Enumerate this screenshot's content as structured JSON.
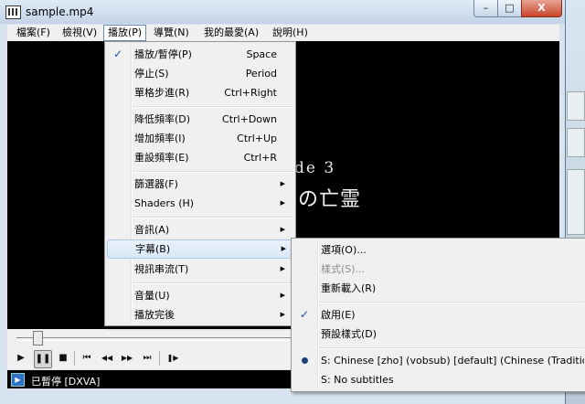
{
  "window": {
    "title": "sample.mp4",
    "buttons": {
      "minimize": "–",
      "maximize": "□",
      "close": "X"
    }
  },
  "menubar": [
    "檔案(F)",
    "檢視(V)",
    "播放(P)",
    "導覽(N)",
    "我的最愛(A)",
    "說明(H)"
  ],
  "play_menu": {
    "items": [
      {
        "label": "播放/暫停(P)",
        "shortcut": "Space",
        "checked": true
      },
      {
        "label": "停止(S)",
        "shortcut": "Period"
      },
      {
        "label": "單格步進(R)",
        "shortcut": "Ctrl+Right"
      },
      {
        "label": "降低頻率(D)",
        "shortcut": "Ctrl+Down"
      },
      {
        "label": "增加頻率(I)",
        "shortcut": "Ctrl+Up"
      },
      {
        "label": "重設頻率(E)",
        "shortcut": "Ctrl+R"
      },
      {
        "label": "篩選器(F)",
        "submenu": true
      },
      {
        "label": "Shaders (H)",
        "submenu": true
      },
      {
        "label": "音訊(A)",
        "submenu": true
      },
      {
        "label": "字幕(B)",
        "submenu": true,
        "highlighted": true
      },
      {
        "label": "視訊串流(T)",
        "submenu": true
      },
      {
        "label": "音量(U)",
        "submenu": true
      },
      {
        "label": "播放完後",
        "submenu": true
      }
    ]
  },
  "subtitle_menu": {
    "items": [
      {
        "label": "選項(O)..."
      },
      {
        "label": "樣式(S)...",
        "disabled": true
      },
      {
        "label": "重新載入(R)"
      },
      {
        "label": "啟用(E)",
        "checked": true
      },
      {
        "label": "預設樣式(D)"
      },
      {
        "label": "S: Chinese [zho] (vobsub) [default] (Chinese (Traditional))",
        "selected": true
      },
      {
        "label": "S: No subtitles"
      }
    ]
  },
  "video": {
    "subtitle_line1": "de 3",
    "subtitle_line2": "の亡霊"
  },
  "controls": {
    "play": "▶",
    "pause": "❚❚",
    "stop": "■",
    "prev": "⏮",
    "rewind": "◀◀",
    "forward": "▶▶",
    "next": "⏭",
    "frame_step": "❚▶"
  },
  "seek": {
    "position_fraction": 0.03
  },
  "status": {
    "text": "已暫停 [DXVA]",
    "icon": "mpc-logo-icon"
  }
}
